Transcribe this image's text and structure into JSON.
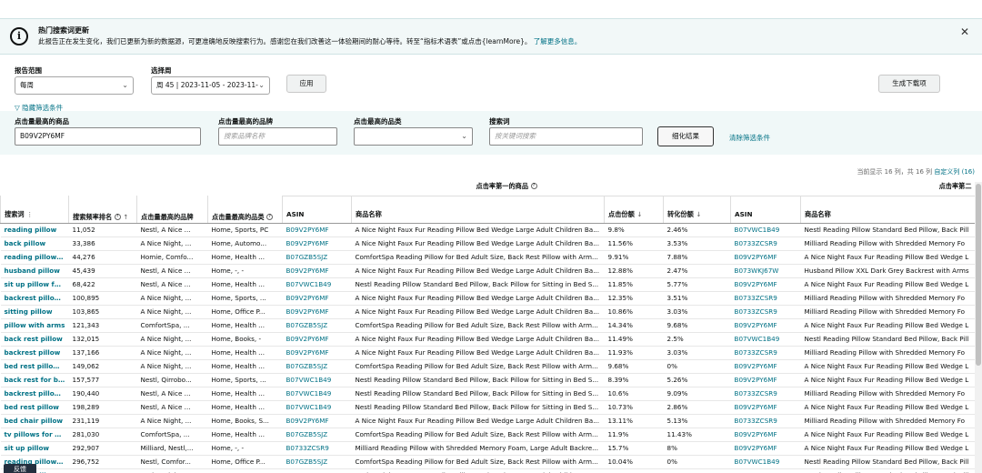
{
  "banner": {
    "title": "热门搜索词更新",
    "body": "此报告正在发生变化，我们已更新为新的数据源，可更准确地反映搜索行为。感谢您在我们改善这一体验期间的耐心等待。转至“指标术语表”或点击{learnMore}。",
    "link": "了解更多信息。"
  },
  "report_scope": {
    "label": "报告范围",
    "value": "每周"
  },
  "select_week": {
    "label": "选择周",
    "value": "周 45 | 2023-11-05 - 2023-11-"
  },
  "apply_label": "应用",
  "download_label": "生成下载项",
  "hide_filters_label": "隐藏筛选条件",
  "filters": {
    "top_product": {
      "label": "点击量最高的商品",
      "value": "B09V2PY6MF"
    },
    "top_brand": {
      "label": "点击量最高的品牌",
      "placeholder": "搜索品牌名称"
    },
    "top_category": {
      "label": "点击最高的品类",
      "value": ""
    },
    "search_term": {
      "label": "搜索词",
      "placeholder": "按关键词搜索"
    },
    "refine_label": "细化结果",
    "clear_label": "清除筛选条件"
  },
  "table_meta": {
    "showing": "当前显示 16 列，共 16 列",
    "customize": "自定义列 (16)"
  },
  "group_headers": {
    "first": "点击率第一的商品",
    "second": "点击率第二"
  },
  "columns": {
    "term": "搜索词",
    "rank": "搜索频率排名",
    "brand": "点击量最高的品牌",
    "category": "点击量最高的品类",
    "asin": "ASIN",
    "title": "商品名称",
    "click_share": "点击份额",
    "conv_share": "转化份额",
    "asin2": "ASIN",
    "title2": "商品名称"
  },
  "rows": [
    [
      "reading pillow",
      "11,052",
      "Nestl, A Nice ...",
      "Home, Sports, PC",
      "B09V2PY6MF",
      "A Nice Night Faux Fur Reading Pillow Bed Wedge Large Adult Children Ba...",
      "9.8%",
      "2.46%",
      "B07VWC1B49",
      "Nestl Reading Pillow Standard Bed Pillow, Back Pill"
    ],
    [
      "back pillow",
      "33,386",
      "A Nice Night, ...",
      "Home, Automo...",
      "B09V2PY6MF",
      "A Nice Night Faux Fur Reading Pillow Bed Wedge Large Adult Children Ba...",
      "11.56%",
      "3.53%",
      "B0733ZCSR9",
      "Milliard Reading Pillow with Shredded Memory Fo"
    ],
    [
      "reading pillows fo",
      "44,276",
      "Homie, Comfo...",
      "Home, Health ...",
      "B07GZB5SJZ",
      "ComfortSpa Reading Pillow for Bed Adult Size, Back Rest Pillow with Arm...",
      "9.91%",
      "7.88%",
      "B09V2PY6MF",
      "A Nice Night Faux Fur Reading Pillow Bed Wedge L"
    ],
    [
      "husband pillow",
      "45,439",
      "Nestl, A Nice ...",
      "Home, -, -",
      "B09V2PY6MF",
      "A Nice Night Faux Fur Reading Pillow Bed Wedge Large Adult Children Ba...",
      "12.88%",
      "2.47%",
      "B073WKJ67W",
      "Husband Pillow XXL Dark Grey Backrest with Arms"
    ],
    [
      "sit up pillow for be",
      "68,422",
      "Nestl, A Nice ...",
      "Home, Health ...",
      "B07VWC1B49",
      "Nestl Reading Pillow Standard Bed Pillow, Back Pillow for Sitting in Bed S...",
      "11.85%",
      "5.77%",
      "B09V2PY6MF",
      "A Nice Night Faux Fur Reading Pillow Bed Wedge L"
    ],
    [
      "backrest pillow wi",
      "100,895",
      "A Nice Night, ...",
      "Home, Sports, ...",
      "B09V2PY6MF",
      "A Nice Night Faux Fur Reading Pillow Bed Wedge Large Adult Children Ba...",
      "12.35%",
      "3.51%",
      "B0733ZCSR9",
      "Milliard Reading Pillow with Shredded Memory Fo"
    ],
    [
      "sitting pillow",
      "103,865",
      "A Nice Night, ...",
      "Home, Office P...",
      "B09V2PY6MF",
      "A Nice Night Faux Fur Reading Pillow Bed Wedge Large Adult Children Ba...",
      "10.86%",
      "3.03%",
      "B0733ZCSR9",
      "Milliard Reading Pillow with Shredded Memory Fo"
    ],
    [
      "pillow with arms",
      "121,343",
      "ComfortSpa, ...",
      "Home, Health ...",
      "B07GZB5SJZ",
      "ComfortSpa Reading Pillow for Bed Adult Size, Back Rest Pillow with Arm...",
      "14.34%",
      "9.68%",
      "B09V2PY6MF",
      "A Nice Night Faux Fur Reading Pillow Bed Wedge L"
    ],
    [
      "back rest pillow",
      "132,015",
      "A Nice Night, ...",
      "Home, Books, -",
      "B09V2PY6MF",
      "A Nice Night Faux Fur Reading Pillow Bed Wedge Large Adult Children Ba...",
      "11.49%",
      "2.5%",
      "B07VWC1B49",
      "Nestl Reading Pillow Standard Bed Pillow, Back Pill"
    ],
    [
      "backrest pillow",
      "137,166",
      "A Nice Night, ...",
      "Home, Health ...",
      "B09V2PY6MF",
      "A Nice Night Faux Fur Reading Pillow Bed Wedge Large Adult Children Ba...",
      "11.93%",
      "3.03%",
      "B0733ZCSR9",
      "Milliard Reading Pillow with Shredded Memory Fo"
    ],
    [
      "bed rest pillow wit",
      "149,062",
      "A Nice Night, ...",
      "Home, Health ...",
      "B07GZB5SJZ",
      "ComfortSpa Reading Pillow for Bed Adult Size, Back Rest Pillow with Arm...",
      "9.68%",
      "0%",
      "B09V2PY6MF",
      "A Nice Night Faux Fur Reading Pillow Bed Wedge L"
    ],
    [
      "back rest for bed s",
      "157,577",
      "Nestl, Qirrobo...",
      "Home, Sports, ...",
      "B07VWC1B49",
      "Nestl Reading Pillow Standard Bed Pillow, Back Pillow for Sitting in Bed S...",
      "8.39%",
      "5.26%",
      "B09V2PY6MF",
      "A Nice Night Faux Fur Reading Pillow Bed Wedge L"
    ],
    [
      "backrest pillows fo",
      "190,440",
      "Nestl, A Nice ...",
      "Home, Health ...",
      "B07VWC1B49",
      "Nestl Reading Pillow Standard Bed Pillow, Back Pillow for Sitting in Bed S...",
      "10.6%",
      "9.09%",
      "B0733ZCSR9",
      "Milliard Reading Pillow with Shredded Memory Fo"
    ],
    [
      "bed rest pillow",
      "198,289",
      "Nestl, A Nice ...",
      "Home, Health ...",
      "B07VWC1B49",
      "Nestl Reading Pillow Standard Bed Pillow, Back Pillow for Sitting in Bed S...",
      "10.73%",
      "2.86%",
      "B09V2PY6MF",
      "A Nice Night Faux Fur Reading Pillow Bed Wedge L"
    ],
    [
      "bed chair pillow",
      "231,119",
      "A Nice Night, ...",
      "Home, Books, S...",
      "B09V2PY6MF",
      "A Nice Night Faux Fur Reading Pillow Bed Wedge Large Adult Children Ba...",
      "13.11%",
      "5.13%",
      "B0733ZCSR9",
      "Milliard Reading Pillow with Shredded Memory Fo"
    ],
    [
      "tv pillows for sitti",
      "281,030",
      "ComfortSpa, ...",
      "Home, Health ...",
      "B07GZB5SJZ",
      "ComfortSpa Reading Pillow for Bed Adult Size, Back Rest Pillow with Arm...",
      "11.9%",
      "11.43%",
      "B09V2PY6MF",
      "A Nice Night Faux Fur Reading Pillow Bed Wedge L"
    ],
    [
      "sit up pillow",
      "292,907",
      "Milliard, Nestl,...",
      "Home, -, -",
      "B0733ZCSR9",
      "Milliard Reading Pillow with Shredded Memory Foam, Large Adult Backre...",
      "15.7%",
      "8%",
      "B09V2PY6MF",
      "A Nice Night Faux Fur Reading Pillow Bed Wedge L"
    ],
    [
      "reading pillow for",
      "296,752",
      "Nestl, Comfor...",
      "Home, Office P...",
      "B07GZB5SJZ",
      "ComfortSpa Reading Pillow for Bed Adult Size, Back Rest Pillow with Arm...",
      "10.04%",
      "0%",
      "B07VWC1B49",
      "Nestl Reading Pillow Standard Bed Pillow, Back Pill"
    ],
    [
      "reading pillow for",
      "309,761",
      "A Nice Night, ...",
      "Home, -, -",
      "B09V2PY6MF",
      "A Nice Night Faux Fur Reading Pillow Bed Wedge Large Adult Children Ba...",
      "11.79%",
      "8%",
      "B07VWC1B49",
      "Nestl Reading Pillow Standard Bed Pillow, Back Pill"
    ]
  ],
  "feedback_label": "反馈"
}
